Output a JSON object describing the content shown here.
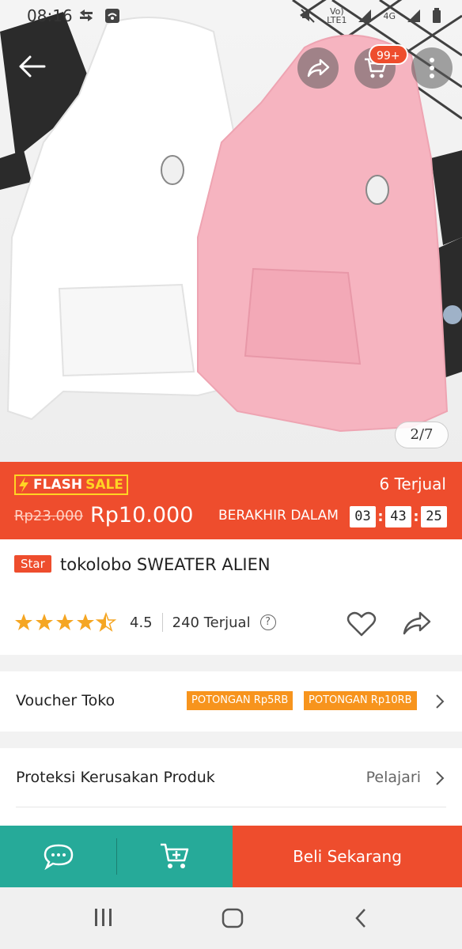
{
  "status_bar": {
    "time": "08:16",
    "network_top": "Vo)",
    "network_bottom": "LTE1",
    "network_type": "4G",
    "icons": [
      "download-icon",
      "wifi-icon",
      "mute-icon",
      "signal-icon",
      "battery-icon"
    ]
  },
  "header": {
    "cart_badge": "99+",
    "image_counter": "2/7",
    "icons": [
      "back-arrow-icon",
      "share-icon",
      "cart-icon",
      "more-vertical-icon"
    ]
  },
  "flash_sale": {
    "label_part1": "FLASH",
    "label_part2": "SALE",
    "original_price": "Rp23.000",
    "sale_price": "Rp10.000",
    "sold": "6 Terjual",
    "ends_label": "BERAKHIR DALAM",
    "timer": {
      "hours": "03",
      "minutes": "43",
      "seconds": "25"
    }
  },
  "product": {
    "badge": "Star",
    "title": "tokolobo SWEATER ALIEN",
    "rating": "4.5",
    "rating_stars": 4.5,
    "sold_total": "240 Terjual",
    "help_symbol": "?"
  },
  "voucher": {
    "label": "Voucher Toko",
    "tags": [
      "POTONGAN Rp5RB",
      "POTONGAN Rp10RB"
    ]
  },
  "protection": {
    "label": "Proteksi Kerusakan Produk",
    "link": "Pelajari"
  },
  "actions": {
    "buy_now": "Beli Sekarang"
  },
  "colors": {
    "brand": "#ee4d2d",
    "teal": "#26aa99",
    "flash_yellow": "#ffd424",
    "voucher_orange": "#f7941d",
    "star": "#f5a623"
  }
}
